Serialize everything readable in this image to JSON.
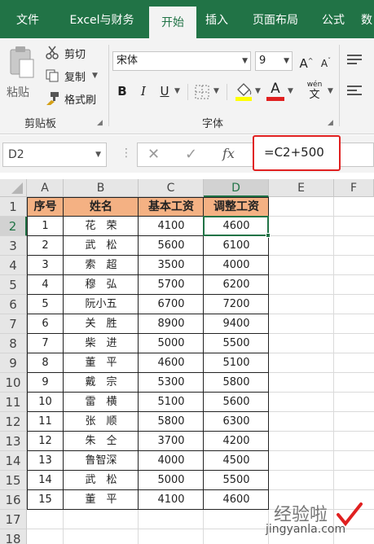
{
  "tabs": [
    "文件",
    "Excel与财务",
    "开始",
    "插入",
    "页面布局",
    "公式",
    "数"
  ],
  "active_tab_index": 2,
  "clipboard": {
    "paste_label": "粘贴",
    "cut_label": "剪切",
    "copy_label": "复制",
    "format_painter_label": "格式刷",
    "group_label": "剪贴板"
  },
  "font": {
    "font_name": "宋体",
    "font_size": "9",
    "bold": "B",
    "italic": "I",
    "underline": "U",
    "font_color_letter": "A",
    "phonetic_label": "wén",
    "grow_label": "A",
    "shrink_label": "A",
    "group_label": "字体"
  },
  "formula_bar": {
    "name_box": "D2",
    "cancel_symbol": "✕",
    "enter_symbol": "✓",
    "fx_label": "fx",
    "formula": "=C2+500"
  },
  "columns": [
    "A",
    "B",
    "C",
    "D",
    "E",
    "F"
  ],
  "selected_column": "D",
  "rows": [
    "1",
    "2",
    "3",
    "4",
    "5",
    "6",
    "7",
    "8",
    "9",
    "10",
    "11",
    "12",
    "13",
    "14",
    "15",
    "16",
    "17",
    "18"
  ],
  "selected_row": "2",
  "table": {
    "headers": [
      "序号",
      "姓名",
      "基本工资",
      "调整工资"
    ],
    "data": [
      [
        "1",
        "花　荣",
        "4100",
        "4600"
      ],
      [
        "2",
        "武　松",
        "5600",
        "6100"
      ],
      [
        "3",
        "索　超",
        "3500",
        "4000"
      ],
      [
        "4",
        "穆　弘",
        "5700",
        "6200"
      ],
      [
        "5",
        "阮小五",
        "6700",
        "7200"
      ],
      [
        "6",
        "关　胜",
        "8900",
        "9400"
      ],
      [
        "7",
        "柴　进",
        "5000",
        "5500"
      ],
      [
        "8",
        "董　平",
        "4600",
        "5100"
      ],
      [
        "9",
        "戴　宗",
        "5300",
        "5800"
      ],
      [
        "10",
        "雷　横",
        "5100",
        "5600"
      ],
      [
        "11",
        "张　顺",
        "5800",
        "6300"
      ],
      [
        "12",
        "朱　仝",
        "3700",
        "4200"
      ],
      [
        "13",
        "鲁智深",
        "4000",
        "4500"
      ],
      [
        "14",
        "武　松",
        "5000",
        "5500"
      ],
      [
        "15",
        "董　平",
        "4100",
        "4600"
      ]
    ]
  },
  "watermark": {
    "text": "经验啦",
    "url": "jingyanla.com"
  },
  "colors": {
    "ribbon_green": "#217346",
    "header_fill": "#f4b183",
    "highlight_red": "#e02020",
    "font_color_swatch": "#e02020",
    "fill_color_swatch": "#ffff00"
  }
}
